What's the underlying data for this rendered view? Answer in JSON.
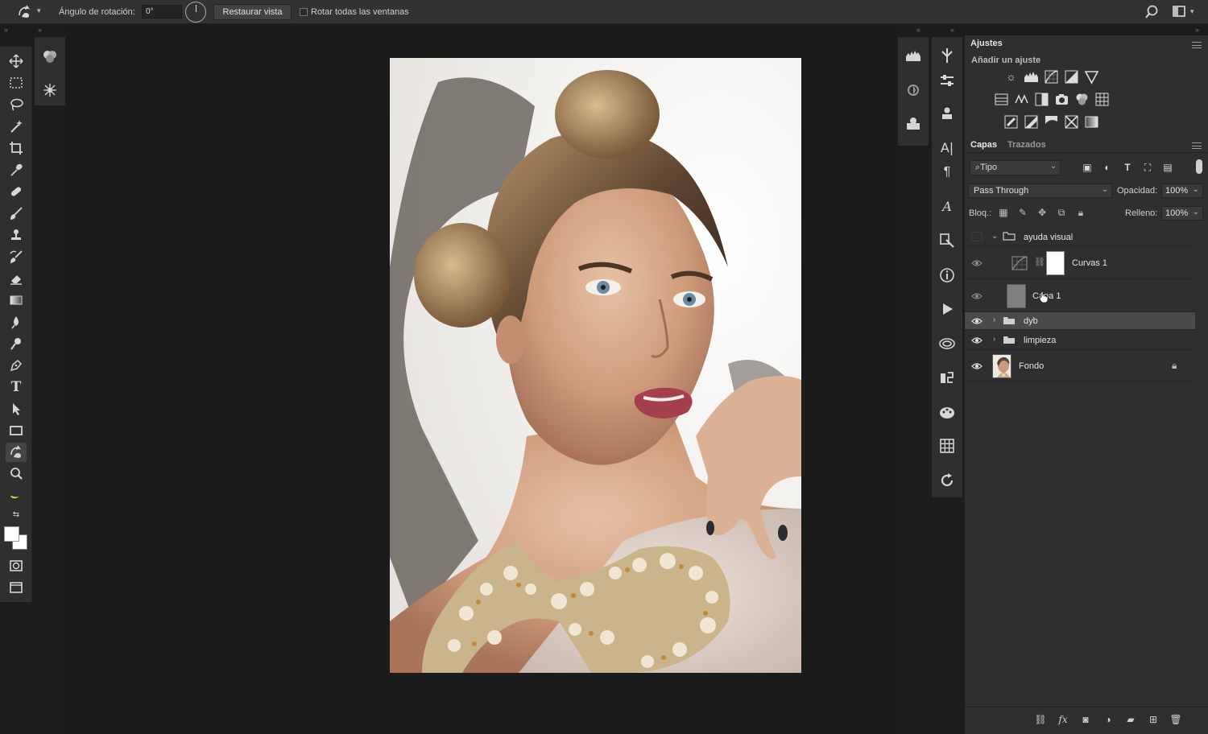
{
  "options_bar": {
    "rotation_label": "Ángulo de rotación:",
    "rotation_value": "0°",
    "restore_button": "Restaurar vista",
    "rotate_all_label": "Rotar todas las ventanas",
    "rotate_all_checked": false
  },
  "adjustments_panel": {
    "title": "Ajustes",
    "subtitle": "Añadir un ajuste",
    "row1": [
      "brightness-contrast-icon",
      "levels-icon",
      "curves-icon",
      "exposure-icon",
      "vibrance-icon"
    ],
    "row2": [
      "hue-saturation-icon",
      "color-balance-icon",
      "black-white-icon",
      "photo-filter-icon",
      "channel-mixer-icon",
      "color-lookup-icon"
    ],
    "row3": [
      "invert-icon",
      "posterize-icon",
      "threshold-icon",
      "selective-color-icon",
      "gradient-map-icon"
    ]
  },
  "layers_panel": {
    "tabs": [
      "Capas",
      "Trazados"
    ],
    "active_tab": "Capas",
    "filter": "Tipo",
    "blend_mode": "Pass Through",
    "opacity_label": "Opacidad:",
    "opacity_value": "100%",
    "lock_label": "Bloq.:",
    "fill_label": "Relleno:",
    "fill_value": "100%",
    "layers": [
      {
        "name": "ayuda visual",
        "type": "group",
        "expanded": true,
        "visible": false
      },
      {
        "name": "Curvas 1",
        "type": "adjustment",
        "visible": true,
        "dimmed": true
      },
      {
        "name": "Capa 1",
        "type": "fill",
        "visible": true,
        "dimmed": true
      },
      {
        "name": "dyb",
        "type": "group",
        "expanded": false,
        "visible": true,
        "selected": true
      },
      {
        "name": "limpieza",
        "type": "group",
        "expanded": false,
        "visible": true
      },
      {
        "name": "Fondo",
        "type": "background",
        "visible": true,
        "locked": true
      }
    ]
  },
  "colors": {
    "foreground": "#ffffff",
    "background": "#ffffff",
    "panel": "#2f2f2f",
    "canvas": "#1b1b1b"
  }
}
